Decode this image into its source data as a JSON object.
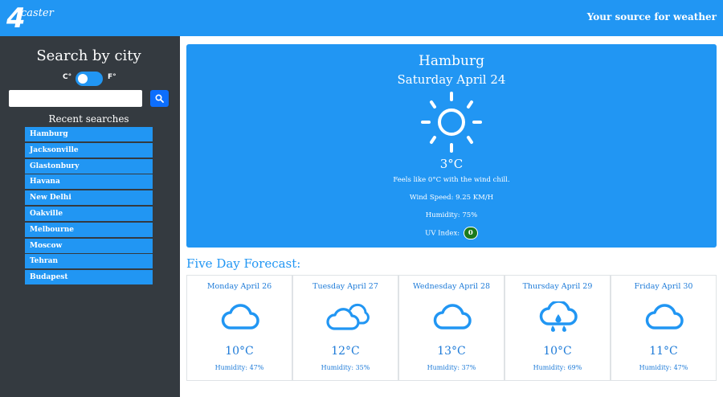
{
  "header": {
    "logo_number": "4",
    "logo_word": "caster",
    "tagline": "Your source for weather"
  },
  "sidebar": {
    "title": "Search by city",
    "unit_c": "C°",
    "unit_f": "F°",
    "toggle_on": true,
    "search_value": "",
    "search_placeholder": "",
    "recent_title": "Recent searches",
    "recent": [
      "Hamburg",
      "Jacksonville",
      "Glastonbury",
      "Havana",
      "New Delhi",
      "Oakville",
      "Melbourne",
      "Moscow",
      "Tehran",
      "Budapest"
    ]
  },
  "today": {
    "city": "Hamburg",
    "date": "Saturday April 24",
    "icon": "sun-icon",
    "temp": "3°C",
    "feels": "Feels like 0°C with the wind chill.",
    "wind": "Wind Speed: 9.25 KM/H",
    "humidity": "Humidity: 75%",
    "uv_label": "UV Index:",
    "uv_value": "0",
    "uv_color": "#1b7a1b"
  },
  "forecast_title": "Five Day Forecast:",
  "forecast": [
    {
      "date": "Monday April 26",
      "icon": "cloud-icon",
      "temp": "10°C",
      "humidity": "Humidity: 47%"
    },
    {
      "date": "Tuesday April 27",
      "icon": "clouds-icon",
      "temp": "12°C",
      "humidity": "Humidity: 35%"
    },
    {
      "date": "Wednesday April 28",
      "icon": "cloud-icon",
      "temp": "13°C",
      "humidity": "Humidity: 37%"
    },
    {
      "date": "Thursday April 29",
      "icon": "rain-cloud-icon",
      "temp": "10°C",
      "humidity": "Humidity: 69%"
    },
    {
      "date": "Friday April 30",
      "icon": "cloud-icon",
      "temp": "11°C",
      "humidity": "Humidity: 47%"
    }
  ],
  "colors": {
    "accent": "#2196f3",
    "sidebar": "#343a40",
    "button": "#0d6efd"
  }
}
